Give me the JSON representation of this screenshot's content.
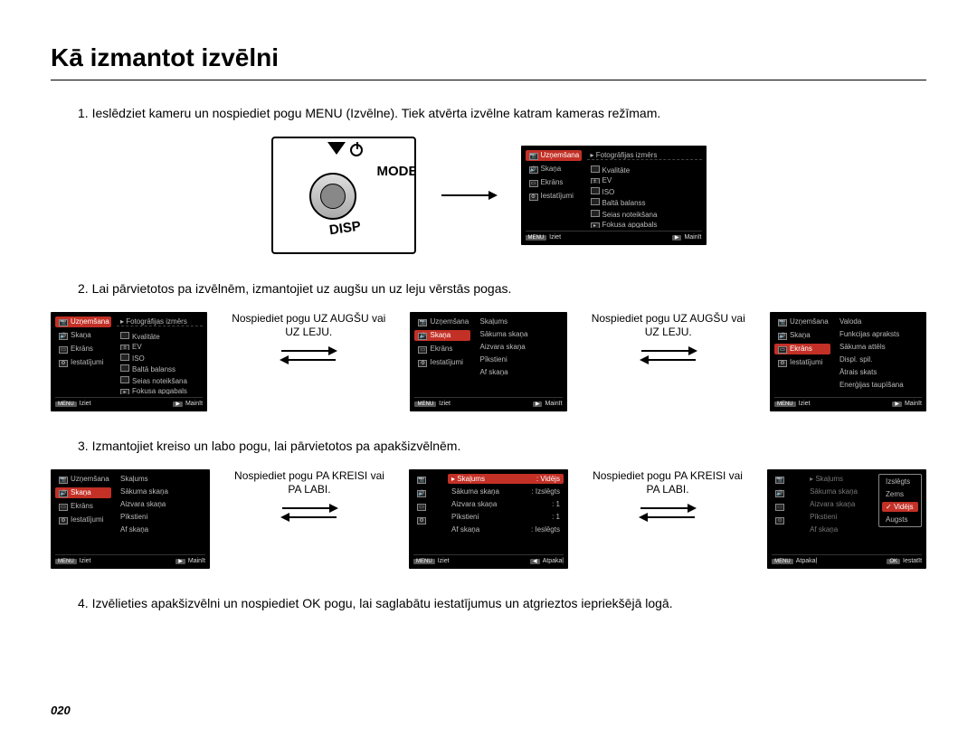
{
  "title": "Kā izmantot izvēlni",
  "page_number": "020",
  "steps": {
    "s1": "1. Ieslēdziet kameru un nospiediet pogu MENU (Izvēlne). Tiek atvērta izvēlne katram kameras režīmam.",
    "s2": "2. Lai pārvietotos pa izvēlnēm, izmantojiet uz augšu un uz leju vērstās pogas.",
    "s3": "3. Izmantojiet kreiso un labo pogu, lai pārvietotos pa apakšizvēlnēm.",
    "s4": "4. Izvēlieties apakšizvēlni un nospiediet OK pogu, lai saglabātu iestatījumus un atgrieztos iepriekšējā logā."
  },
  "camera": {
    "mode": "MODE",
    "disp": "DISP"
  },
  "arrows": {
    "updown": "Nospiediet pogu UZ AUGŠU vai UZ LEJU.",
    "leftright": "Nospiediet pogu PA KREISI vai PA LABI."
  },
  "labels": {
    "uznemsana": "Uzņemšana",
    "skana": "Skaņa",
    "ekrans": "Ekrāns",
    "iestatijumi": "Iestatījumi",
    "fotografijas_izmers": "Fotogrāfijas izmērs",
    "kvalitate": "Kvalitāte",
    "ev": "EV",
    "iso": "ISO",
    "balta_balanss": "Baltā balanss",
    "sejas_noteiksana": "Sejas noteikšana",
    "fokusa_apgabals": "Fokusa apgabals",
    "skalums": "Skaļums",
    "sakuma_skana": "Sākuma skaņa",
    "aizvara_skana": "Aizvara skaņa",
    "pikstieni": "Pīkstieni",
    "af_skana": "Af skaņa",
    "valoda": "Valoda",
    "funkcijas_apraksts": "Funkcijas apraksts",
    "sakuma_attels": "Sākuma attēls",
    "displ_spil": "Displ. spil.",
    "atrais_skats": "Ātrais skats",
    "energijas_taupisana": "Enerģijas taupīšana",
    "videjs": "Vidējs",
    "izslegts": "Izslēgts",
    "zems": "Zems",
    "augsts": "Augsts",
    "ieslegts": "Ieslēgts",
    "v1": "1"
  },
  "footer": {
    "menu": "MENU",
    "iziet": "Iziet",
    "mainit": "Mainīt",
    "atpakal": "Atpakaļ",
    "iestatit": "Iestatīt"
  }
}
